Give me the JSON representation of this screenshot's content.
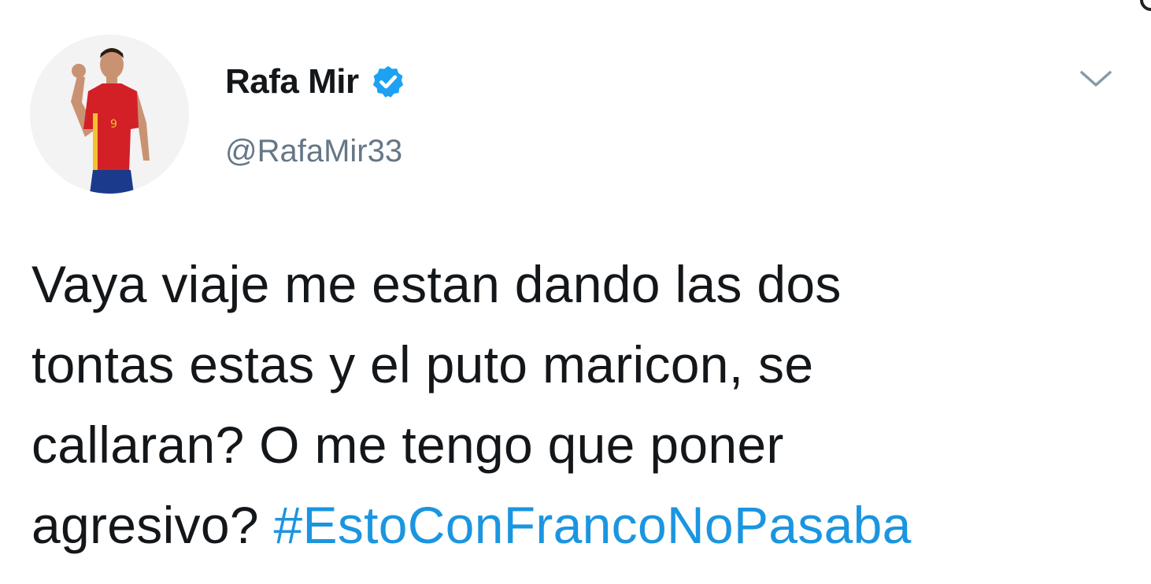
{
  "user": {
    "display_name": "Rafa Mir",
    "handle": "@RafaMir33",
    "verified": true,
    "avatar_icon": "profile-photo"
  },
  "tweet": {
    "lines": [
      "Vaya viaje me estan dando las dos",
      "tontas estas y el puto maricon, se",
      "callaran? O me tengo que poner"
    ],
    "last_line_text": "agresivo? ",
    "hashtag": "#EstoConFrancoNoPasaba"
  },
  "icons": {
    "verified": "verified-badge-icon",
    "menu": "chevron-down-icon"
  },
  "colors": {
    "text": "#14171a",
    "handle": "#657786",
    "hashtag": "#1b95e0",
    "verified": "#1da1f2"
  }
}
